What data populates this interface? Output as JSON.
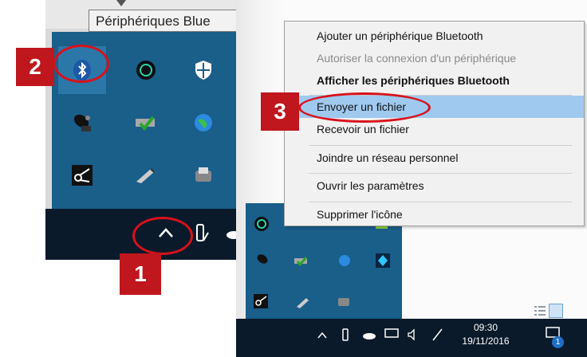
{
  "tooltip": {
    "text": "Périphériques Blue"
  },
  "callouts": {
    "one": "1",
    "two": "2",
    "three": "3"
  },
  "context_menu": {
    "items": [
      {
        "label": "Ajouter un périphérique Bluetooth",
        "state": "normal"
      },
      {
        "label": "Autoriser la connexion d'un périphérique",
        "state": "disabled"
      },
      {
        "label": "Afficher les périphériques Bluetooth",
        "state": "bold"
      },
      {
        "label": "Envoyer un fichier",
        "state": "highlighted"
      },
      {
        "label": "Recevoir un fichier",
        "state": "normal"
      },
      {
        "label": "Joindre un réseau personnel",
        "state": "normal"
      },
      {
        "label": "Ouvrir les paramètres",
        "state": "normal"
      },
      {
        "label": "Supprimer l'icône",
        "state": "normal"
      }
    ]
  },
  "clock": {
    "time": "09:30",
    "date": "19/11/2016"
  },
  "notification_badge": "1",
  "colors": {
    "accent_red": "#c0161d",
    "menu_highlight": "#9fc9ef",
    "tray_blue": "#1a5e8a",
    "taskbar": "#0b1a2a"
  }
}
